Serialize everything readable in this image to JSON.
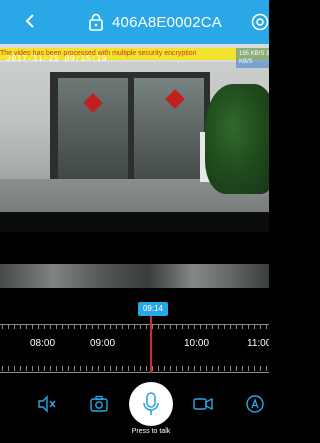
{
  "header": {
    "title": "406A8E0002CA",
    "back_icon": "chevron-left-icon",
    "lock_icon": "lock-icon",
    "settings_icon": "gear-icon",
    "background": "#2aa7e6"
  },
  "video": {
    "timestamp": "2017-11-25 09:15:19",
    "data_rate": "195 KB/S 3 KB/S",
    "encryption_notice": "The video has been processed with multiple security encryption"
  },
  "timeline": {
    "current_time": "09:14",
    "hours": [
      "08:00",
      "09:00",
      "10:00",
      "11:00"
    ],
    "accent": "#2aa7e6",
    "cursor_color": "#d22a2a"
  },
  "controls": {
    "mute_icon": "speaker-mute-icon",
    "snapshot_icon": "camera-icon",
    "talk_icon": "microphone-icon",
    "talk_label": "Press to talk",
    "record_icon": "video-record-icon",
    "auto_icon": "auto-mode-icon"
  }
}
